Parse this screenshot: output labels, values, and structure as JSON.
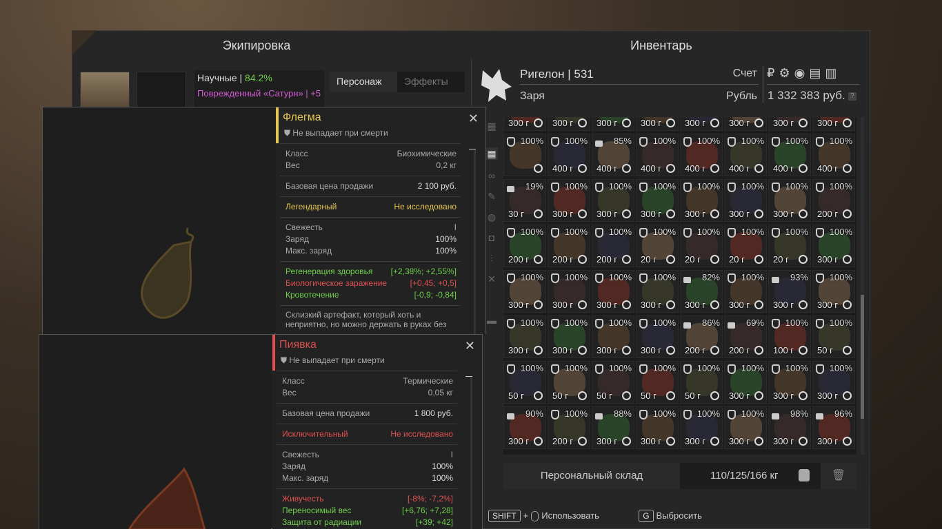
{
  "equipment": {
    "title": "Экипировка",
    "science_label": "Научные |",
    "science_value": "84.2%",
    "damaged_item": "Поврежденный «Сатурн» | +5",
    "tab_character": "Персонаж",
    "tab_effects": "Эффекты"
  },
  "inventory": {
    "title": "Инвентарь",
    "character_name": "Ригелон | 531",
    "faction": "Заря",
    "account_label": "Счет",
    "currency_label": "Рубль",
    "money": "1 332 383 руб.",
    "help": "?",
    "storage_label": "Персональный склад",
    "weight": "110/125/166 кг",
    "hint_shift": "SHIFT",
    "hint_plus": "+",
    "hint_use": "Использовать",
    "hint_g": "G",
    "hint_drop": "Выбросить",
    "grid": [
      [
        {
          "w": "300 г",
          "p": ""
        },
        {
          "w": "300 г",
          "p": ""
        },
        {
          "w": "300 г",
          "p": ""
        },
        {
          "w": "300 г",
          "p": ""
        },
        {
          "w": "300 г",
          "p": ""
        },
        {
          "w": "300 г",
          "p": ""
        },
        {
          "w": "300 г",
          "p": ""
        },
        {
          "w": "300 г",
          "p": ""
        }
      ],
      [
        {
          "w": "",
          "p": "100%"
        },
        {
          "w": "400 г",
          "p": "100%"
        },
        {
          "w": "400 г",
          "p": "85%",
          "l": 1
        },
        {
          "w": "400 г",
          "p": "100%"
        },
        {
          "w": "400 г",
          "p": "100%"
        },
        {
          "w": "400 г",
          "p": "100%"
        },
        {
          "w": "400 г",
          "p": "100%"
        },
        {
          "w": "400 г",
          "p": "100%"
        }
      ],
      [
        {
          "w": "30 г",
          "p": "19%",
          "l": 1
        },
        {
          "w": "300 г",
          "p": "100%"
        },
        {
          "w": "300 г",
          "p": "100%"
        },
        {
          "w": "300 г",
          "p": "100%"
        },
        {
          "w": "300 г",
          "p": "100%"
        },
        {
          "w": "300 г",
          "p": "100%"
        },
        {
          "w": "300 г",
          "p": "100%"
        },
        {
          "w": "200 г",
          "p": "100%"
        }
      ],
      [
        {
          "w": "200 г",
          "p": "100%"
        },
        {
          "w": "200 г",
          "p": "100%"
        },
        {
          "w": "200 г",
          "p": "100%"
        },
        {
          "w": "20 г",
          "p": "100%"
        },
        {
          "w": "20 г",
          "p": "100%"
        },
        {
          "w": "20 г",
          "p": "100%"
        },
        {
          "w": "20 г",
          "p": "100%"
        },
        {
          "w": "300 г",
          "p": "100%"
        }
      ],
      [
        {
          "w": "300 г",
          "p": "100%"
        },
        {
          "w": "300 г",
          "p": "100%"
        },
        {
          "w": "300 г",
          "p": "100%"
        },
        {
          "w": "300 г",
          "p": "100%"
        },
        {
          "w": "300 г",
          "p": "82%",
          "l": 1
        },
        {
          "w": "300 г",
          "p": "100%"
        },
        {
          "w": "300 г",
          "p": "93%",
          "l": 1
        },
        {
          "w": "300 г",
          "p": "100%"
        }
      ],
      [
        {
          "w": "300 г",
          "p": "100%"
        },
        {
          "w": "300 г",
          "p": "100%"
        },
        {
          "w": "300 г",
          "p": "100%"
        },
        {
          "w": "300 г",
          "p": "100%"
        },
        {
          "w": "200 г",
          "p": "86%",
          "l": 1
        },
        {
          "w": "200 г",
          "p": "69%",
          "l": 1
        },
        {
          "w": "100 г",
          "p": "100%"
        },
        {
          "w": "50 г",
          "p": "100%"
        }
      ],
      [
        {
          "w": "50 г",
          "p": "100%"
        },
        {
          "w": "50 г",
          "p": "100%"
        },
        {
          "w": "50 г",
          "p": "100%"
        },
        {
          "w": "50 г",
          "p": "100%"
        },
        {
          "w": "50 г",
          "p": "100%"
        },
        {
          "w": "300 г",
          "p": "100%"
        },
        {
          "w": "300 г",
          "p": "100%"
        },
        {
          "w": "300 г",
          "p": "100%"
        }
      ],
      [
        {
          "w": "300 г",
          "p": "90%",
          "l": 1
        },
        {
          "w": "200 г",
          "p": "100%"
        },
        {
          "w": "300 г",
          "p": "88%",
          "l": 1
        },
        {
          "w": "300 г",
          "p": "100%"
        },
        {
          "w": "300 г",
          "p": "100%"
        },
        {
          "w": "300 г",
          "p": "100%"
        },
        {
          "w": "300 г",
          "p": "98%",
          "l": 1
        },
        {
          "w": "300 г",
          "p": "96%",
          "l": 1
        }
      ]
    ]
  },
  "tooltip1": {
    "title": "Флегма",
    "subtitle": "Не выпадает при смерти",
    "class_label": "Класс",
    "class_value": "Биохимические",
    "weight_label": "Вес",
    "weight_value": "0,2 кг",
    "price_label": "Базовая цена продажи",
    "price_value": "2 100 руб.",
    "rarity": "Легендарный",
    "research": "Не исследовано",
    "fresh_label": "Свежесть",
    "fresh_value": "I",
    "charge_label": "Заряд",
    "charge_value": "100%",
    "maxcharge_label": "Макс. заряд",
    "maxcharge_value": "100%",
    "s1_label": "Регенерация здоровья",
    "s1_value": "[+2,38%; +2,55%]",
    "s2_label": "Биологическое заражение",
    "s2_value": "[+0,45; +0,5]",
    "s3_label": "Кровотечение",
    "s3_value": "[-0,9; -0,84]",
    "desc": "Склизкий артефакт, который хоть и неприятно, но можно держать в руках без"
  },
  "tooltip2": {
    "title": "Пиявка",
    "subtitle": "Не выпадает при смерти",
    "class_label": "Класс",
    "class_value": "Термические",
    "weight_label": "Вес",
    "weight_value": "0,05 кг",
    "price_label": "Базовая цена продажи",
    "price_value": "1 800 руб.",
    "rarity": "Исключительный",
    "research": "Не исследовано",
    "fresh_label": "Свежесть",
    "fresh_value": "I",
    "charge_label": "Заряд",
    "charge_value": "100%",
    "maxcharge_label": "Макс. заряд",
    "maxcharge_value": "100%",
    "s1_label": "Живучесть",
    "s1_value": "[-8%; -7,2%]",
    "s2_label": "Переносимый вес",
    "s2_value": "[+6,76; +7,28]",
    "s3_label": "Защита от радиации",
    "s3_value": "[+39; +42]"
  },
  "colors": {
    "legendary": "#e7c554",
    "exceptional": "#e05050",
    "positive": "#6fcf4c",
    "negative": "#e05050"
  }
}
